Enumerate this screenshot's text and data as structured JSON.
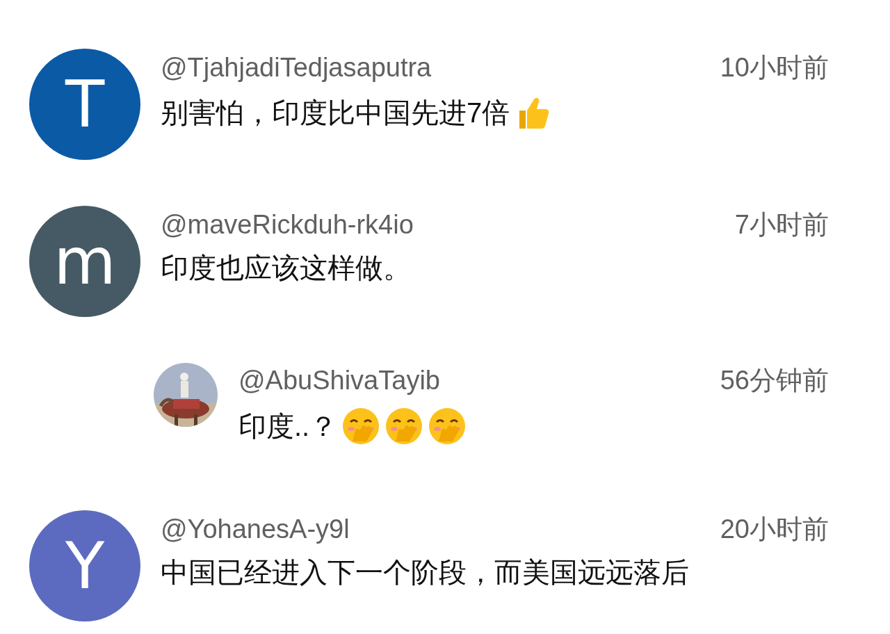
{
  "comments": [
    {
      "avatar": {
        "kind": "letter",
        "initial": "T",
        "color": "#0b5aa6"
      },
      "username": "@TjahjadiTedjasaputra",
      "time": "10小时前",
      "text": "别害怕，印度比中国先进7倍",
      "emoji": [
        {
          "kind": "thumbs_up"
        }
      ],
      "reply": false
    },
    {
      "avatar": {
        "kind": "letter",
        "initial": "m",
        "color": "#455a64"
      },
      "username": "@maveRickduh-rk4io",
      "time": "7小时前",
      "text": "印度也应该这样做。",
      "reply": false
    },
    {
      "avatar": {
        "kind": "picture"
      },
      "username": "@AbuShivaTayib",
      "time": "56分钟前",
      "text": "印度..？",
      "emoji": [
        {
          "kind": "hand_over_mouth"
        },
        {
          "kind": "hand_over_mouth"
        },
        {
          "kind": "hand_over_mouth"
        }
      ],
      "reply": true
    },
    {
      "avatar": {
        "kind": "letter",
        "initial": "Y",
        "color": "#5c6bc0"
      },
      "username": "@YohanesA-y9l",
      "time": "20小时前",
      "text": "中国已经进入下一个阶段，而美国远远落后",
      "reply": false
    }
  ]
}
